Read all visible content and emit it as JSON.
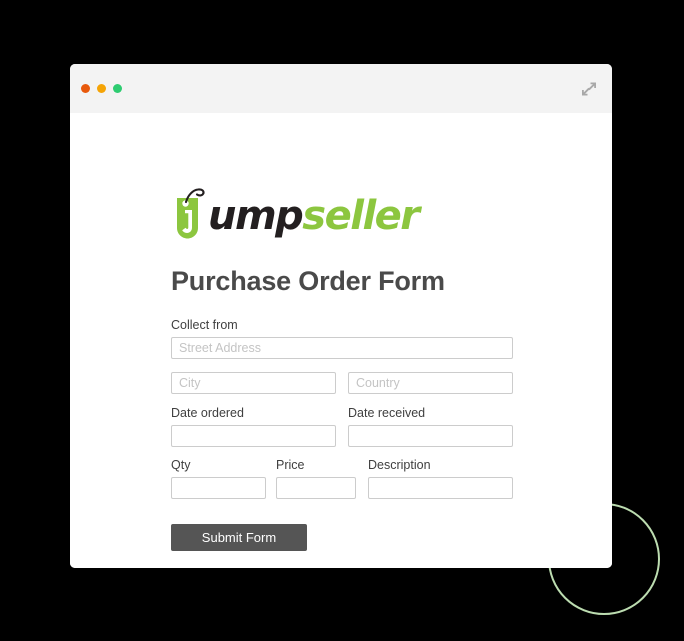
{
  "window": {
    "controls": {
      "close_label": "close",
      "minimize_label": "minimize",
      "maximize_label": "maximize"
    },
    "expand_icon": "expand-icon"
  },
  "brand": {
    "tag_letter": "j",
    "word_black": "ump",
    "word_green": "seller",
    "green_color": "#8cc63f",
    "dark_color": "#231f20"
  },
  "page": {
    "title": "Purchase Order Form"
  },
  "form": {
    "collect_from": {
      "label": "Collect from",
      "street_placeholder": "Street Address",
      "street_value": "",
      "city_placeholder": "City",
      "city_value": "",
      "country_placeholder": "Country",
      "country_value": ""
    },
    "dates": {
      "ordered_label": "Date ordered",
      "ordered_placeholder": "",
      "ordered_value": "",
      "received_label": "Date received",
      "received_placeholder": "",
      "received_value": ""
    },
    "item": {
      "qty_label": "Qty",
      "qty_placeholder": "",
      "qty_value": "",
      "price_label": "Price",
      "price_placeholder": "",
      "price_value": "",
      "description_label": "Description",
      "description_placeholder": "",
      "description_value": ""
    },
    "submit_label": "Submit Form"
  },
  "decoration": {
    "circle_color": "#bcdcb0"
  }
}
